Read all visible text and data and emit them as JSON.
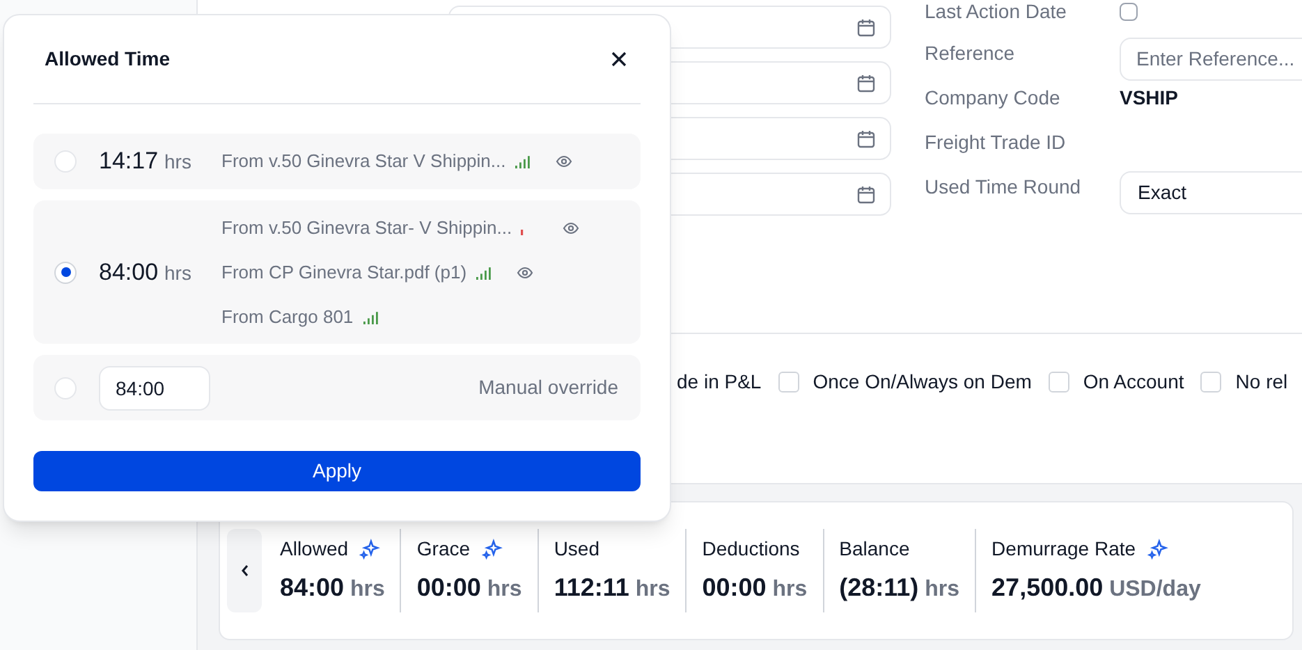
{
  "form": {
    "right_fields": [
      {
        "label": "Last Action Date",
        "kind": "checkbox",
        "checked": false
      },
      {
        "label": "Reference",
        "kind": "input",
        "placeholder": "Enter Reference..."
      },
      {
        "label": "Company Code",
        "kind": "text",
        "value": "VSHIP"
      },
      {
        "label": "Freight Trade ID",
        "kind": "text"
      },
      {
        "label": "Used Time Round",
        "kind": "select",
        "value": "Exact"
      }
    ]
  },
  "options": [
    {
      "label": "de in P&L"
    },
    {
      "label": "Once On/Always on Dem",
      "checked": false
    },
    {
      "label": "On Account",
      "checked": false
    },
    {
      "label": "No rel",
      "checked": false
    }
  ],
  "summary": [
    {
      "label": "Allowed",
      "ai": true,
      "value": "84:00",
      "unit": "hrs"
    },
    {
      "label": "Grace",
      "ai": true,
      "value": "00:00",
      "unit": "hrs"
    },
    {
      "label": "Used",
      "ai": false,
      "value": "112:11",
      "unit": "hrs"
    },
    {
      "label": "Deductions",
      "ai": false,
      "value": "00:00",
      "unit": "hrs"
    },
    {
      "label": "Balance",
      "ai": false,
      "value": "(28:11)",
      "unit": "hrs"
    },
    {
      "label": "Demurrage Rate",
      "ai": true,
      "value": "27,500.00",
      "unit": "USD/day"
    }
  ],
  "dialog": {
    "title": "Allowed Time",
    "choices": [
      {
        "kind": "sources",
        "selected": false,
        "value": "14:17",
        "unit": "hrs",
        "sources": [
          {
            "text": "From v.50 Ginevra Star V Shippin...",
            "color": "#4a9a4a",
            "eye": true
          }
        ]
      },
      {
        "kind": "sources",
        "selected": true,
        "value": "84:00",
        "unit": "hrs",
        "sources": [
          {
            "text": "From v.50 Ginevra Star- V Shippin...",
            "color": "#e05050",
            "eye": true
          },
          {
            "text": "From CP Ginevra Star.pdf (p1)",
            "color": "#4a9a4a",
            "eye": true
          },
          {
            "text": "From Cargo 801",
            "color": "#4a9a4a",
            "eye": false
          }
        ]
      },
      {
        "kind": "manual",
        "selected": false,
        "value": "84:00",
        "label": "Manual override"
      }
    ],
    "apply": "Apply"
  }
}
